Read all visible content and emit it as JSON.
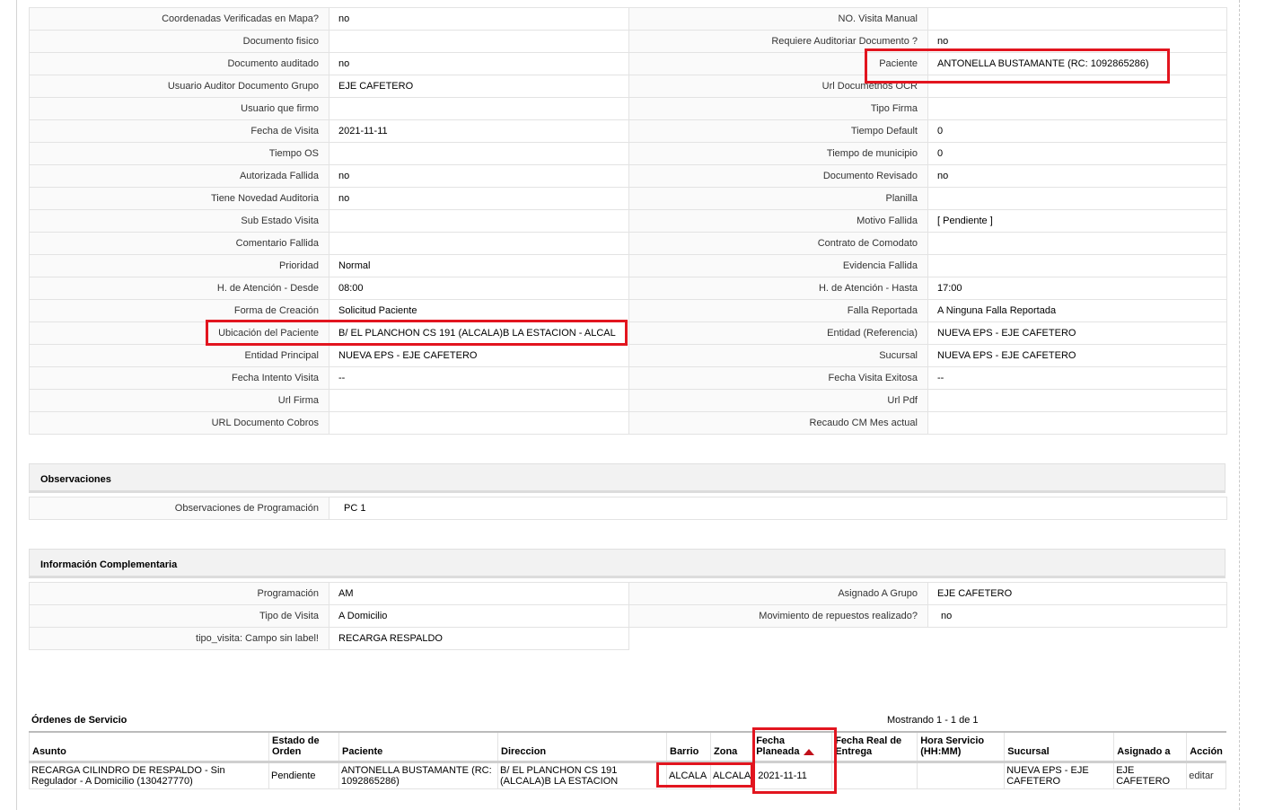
{
  "detail_rows": [
    {
      "l1": "Coordenadas Verificadas en Mapa?",
      "v1": "no",
      "l2": "NO. Visita Manual",
      "v2": ""
    },
    {
      "l1": "Documento fisico",
      "v1": "",
      "l2": "Requiere Auditoriar Documento ?",
      "v2": "no"
    },
    {
      "l1": "Documento auditado",
      "v1": "no",
      "l2": "Paciente",
      "v2": "ANTONELLA BUSTAMANTE (RC: 1092865286)"
    },
    {
      "l1": "Usuario Auditor Documento Grupo",
      "v1": "EJE CAFETERO",
      "l2": "Url Documetnos OCR",
      "v2": ""
    },
    {
      "l1": "Usuario que firmo",
      "v1": "",
      "l2": "Tipo Firma",
      "v2": ""
    },
    {
      "l1": "Fecha de Visita",
      "v1": "2021-11-11",
      "l2": "Tiempo Default",
      "v2": "0"
    },
    {
      "l1": "Tiempo OS",
      "v1": "",
      "l2": "Tiempo de municipio",
      "v2": "0"
    },
    {
      "l1": "Autorizada Fallida",
      "v1": "no",
      "l2": "Documento Revisado",
      "v2": "no"
    },
    {
      "l1": "Tiene Novedad Auditoria",
      "v1": "no",
      "l2": "Planilla",
      "v2": ""
    },
    {
      "l1": "Sub Estado Visita",
      "v1": "",
      "l2": "Motivo Fallida",
      "v2": "[ Pendiente ]"
    },
    {
      "l1": "Comentario Fallida",
      "v1": "",
      "l2": "Contrato de Comodato",
      "v2": ""
    },
    {
      "l1": "Prioridad",
      "v1": "Normal",
      "l2": "Evidencia Fallida",
      "v2": ""
    },
    {
      "l1": "H. de Atención - Desde",
      "v1": "08:00",
      "l2": "H. de Atención - Hasta",
      "v2": "17:00"
    },
    {
      "l1": "Forma de Creación",
      "v1": "Solicitud Paciente",
      "l2": "Falla Reportada",
      "v2": "A Ninguna Falla Reportada"
    },
    {
      "l1": "Ubicación del Paciente",
      "v1": "B/ EL PLANCHON CS 191 (ALCALA)B LA ESTACION - ALCAL",
      "l2": "Entidad (Referencia)",
      "v2": "NUEVA EPS - EJE CAFETERO"
    },
    {
      "l1": "Entidad Principal",
      "v1": "NUEVA EPS - EJE CAFETERO",
      "l2": "Sucursal",
      "v2": "NUEVA EPS - EJE CAFETERO"
    },
    {
      "l1": "Fecha Intento Visita",
      "v1": "--",
      "l2": "Fecha Visita Exitosa",
      "v2": "--"
    },
    {
      "l1": "Url Firma",
      "v1": "",
      "l2": "Url Pdf",
      "v2": ""
    },
    {
      "l1": "URL Documento Cobros",
      "v1": "",
      "l2": "Recaudo CM Mes actual",
      "v2": ""
    }
  ],
  "observaciones": {
    "title": "Observaciones",
    "label": "Observaciones de Programación",
    "value": "PC 1"
  },
  "info_comp": {
    "title": "Información Complementaria",
    "rows": [
      {
        "l1": "Programación",
        "v1": "AM",
        "l2": "Asignado A Grupo",
        "v2": "EJE CAFETERO"
      },
      {
        "l1": "Tipo de Visita",
        "v1": "A Domicilio",
        "l2": "Movimiento de repuestos realizado?",
        "v2": "no"
      },
      {
        "l1": "tipo_visita: Campo sin label!",
        "v1": "RECARGA RESPALDO"
      }
    ]
  },
  "orders": {
    "title": "Órdenes de Servicio",
    "count": "Mostrando 1 - 1 de 1",
    "headers": {
      "asunto": "Asunto",
      "estado": "Estado de Orden",
      "paciente": "Paciente",
      "direccion": "Direccion",
      "barrio": "Barrio",
      "zona": "Zona",
      "fecha_planeada": "Fecha Planeada",
      "fecha_real": "Fecha Real de Entrega",
      "hora": "Hora Servicio (HH:MM)",
      "sucursal": "Sucursal",
      "asignado": "Asignado a",
      "accion": "Acción"
    },
    "row": {
      "asunto": "RECARGA CILINDRO DE RESPALDO - Sin Regulador - A Domicilio (130427770)",
      "estado": "Pendiente",
      "paciente": "ANTONELLA BUSTAMANTE (RC: 1092865286)",
      "direccion": "B/ EL PLANCHON CS 191 (ALCALA)B LA ESTACION",
      "barrio": "ALCALA",
      "zona": "ALCALA",
      "fecha_planeada": "2021-11-11",
      "fecha_real": "",
      "hora": "",
      "sucursal": "NUEVA EPS - EJE CAFETERO",
      "asignado": "EJE CAFETERO",
      "accion": "editar"
    }
  },
  "highlight_color": "#e2151f"
}
